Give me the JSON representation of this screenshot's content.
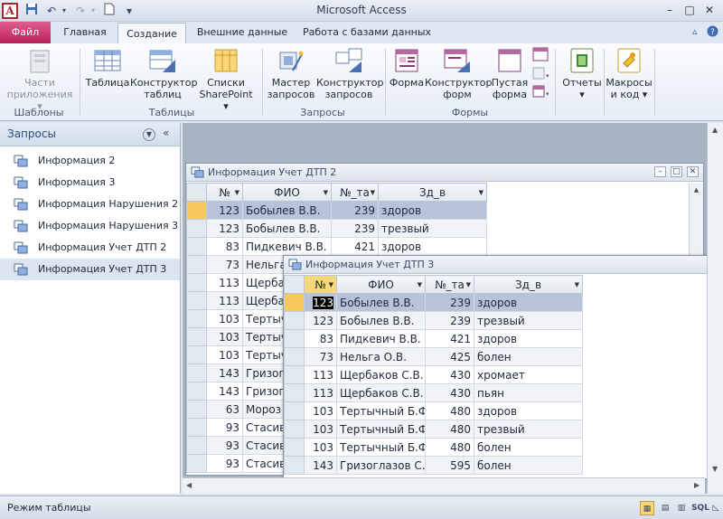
{
  "window": {
    "title": "Microsoft Access",
    "app_icon_letter": "A",
    "minimize": "–",
    "maximize": "□",
    "close": "✕"
  },
  "ribbon_tabs": [
    {
      "label": "Файл"
    },
    {
      "label": "Главная"
    },
    {
      "label": "Создание"
    },
    {
      "label": "Внешние данные"
    },
    {
      "label": "Работа с базами данных"
    }
  ],
  "ribbon": {
    "templates": {
      "btn1_l1": "Части",
      "btn1_l2": "приложения ▾",
      "group": "Шаблоны"
    },
    "tables": {
      "table": "Таблица",
      "designer_l1": "Конструктор",
      "designer_l2": "таблиц",
      "lists_l1": "Списки",
      "lists_l2": "SharePoint ▾",
      "group": "Таблицы"
    },
    "queries": {
      "wizard_l1": "Мастер",
      "wizard_l2": "запросов",
      "designer_l1": "Конструктор",
      "designer_l2": "запросов",
      "group": "Запросы"
    },
    "forms": {
      "form": "Форма",
      "designer_l1": "Конструктор",
      "designer_l2": "форм",
      "blank_l1": "Пустая",
      "blank_l2": "форма",
      "group": "Формы"
    },
    "reports": {
      "label": "Отчеты",
      "arrow": "▾"
    },
    "macros": {
      "l1": "Макросы",
      "l2": "и код ▾"
    }
  },
  "nav": {
    "title": "Запросы",
    "items": [
      {
        "label": "Информация 2"
      },
      {
        "label": "Информация 3"
      },
      {
        "label": "Информация Нарушения 2"
      },
      {
        "label": "Информация Нарушения 3"
      },
      {
        "label": "Информация Учет ДТП 2"
      },
      {
        "label": "Информация Учет ДТП 3"
      }
    ]
  },
  "window2": {
    "title": "Информация Учет ДТП 2",
    "headers": [
      "№",
      "ФИО",
      "№_та",
      "Зд_в"
    ],
    "rows": [
      [
        "123",
        "Бобылев В.В.",
        "239",
        "здоров"
      ],
      [
        "123",
        "Бобылев В.В.",
        "239",
        "трезвый"
      ],
      [
        "83",
        "Пидкевич В.В.",
        "421",
        "здоров"
      ],
      [
        "73",
        "Нельга",
        "",
        ""
      ],
      [
        "113",
        "Щербак",
        "",
        ""
      ],
      [
        "113",
        "Щербак",
        "",
        ""
      ],
      [
        "103",
        "Тертыч",
        "",
        ""
      ],
      [
        "103",
        "Тертыч",
        "",
        ""
      ],
      [
        "103",
        "Тертыч",
        "",
        ""
      ],
      [
        "143",
        "Гризогл",
        "",
        ""
      ],
      [
        "143",
        "Гризогл",
        "",
        ""
      ],
      [
        "63",
        "Мороз",
        "",
        ""
      ],
      [
        "93",
        "Стасив",
        "",
        ""
      ],
      [
        "93",
        "Стасив",
        "",
        ""
      ],
      [
        "93",
        "Стасив",
        "",
        ""
      ]
    ]
  },
  "window3": {
    "title": "Информация Учет ДТП 3",
    "headers": [
      "№",
      "ФИО",
      "№_та",
      "Зд_в"
    ],
    "rows": [
      [
        "123",
        "Бобылев В.В.",
        "239",
        "здоров"
      ],
      [
        "123",
        "Бобылев В.В.",
        "239",
        "трезвый"
      ],
      [
        "83",
        "Пидкевич В.В.",
        "421",
        "здоров"
      ],
      [
        "73",
        "Нельга О.В.",
        "425",
        "болен"
      ],
      [
        "113",
        "Щербаков С.В.",
        "430",
        "хромает"
      ],
      [
        "113",
        "Щербаков С.В.",
        "430",
        "пьян"
      ],
      [
        "103",
        "Тертычный Б.Ф",
        "480",
        "здоров"
      ],
      [
        "103",
        "Тертычный Б.Ф",
        "480",
        "трезвый"
      ],
      [
        "103",
        "Тертычный Б.Ф",
        "480",
        "болен"
      ],
      [
        "143",
        "Гризоглазов С.",
        "595",
        "болен"
      ]
    ]
  },
  "status": {
    "text": "Режим таблицы",
    "sql_label": "SQL"
  }
}
